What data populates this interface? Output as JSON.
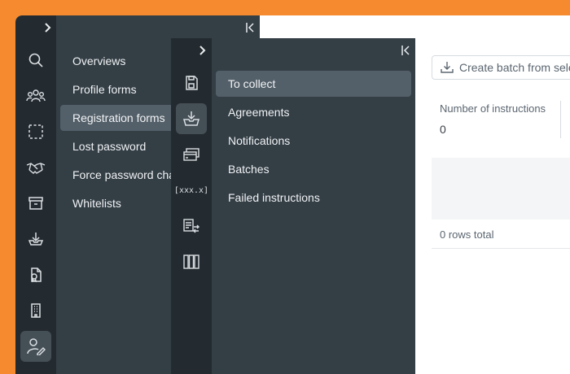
{
  "colors": {
    "background_accent": "#f58a2e",
    "rail_bg": "#242b30",
    "panel_bg": "#333e45",
    "active_item_bg": "#546069"
  },
  "rail1": {
    "icons": [
      "search-icon",
      "users-icon",
      "dashed-square-icon",
      "handshake-icon",
      "archive-icon",
      "download-tray-icon",
      "document-stamp-icon",
      "building-icon",
      "user-edit-icon"
    ],
    "active_icon": "user-edit-icon"
  },
  "panel1": {
    "items": [
      {
        "label": "Overviews"
      },
      {
        "label": "Profile forms"
      },
      {
        "label": "Registration forms"
      },
      {
        "label": "Lost password"
      },
      {
        "label": "Force password cha"
      },
      {
        "label": "Whitelists"
      }
    ],
    "active_item": "Registration forms"
  },
  "rail2": {
    "icons": [
      "floppy-disk-icon",
      "download-tray-icon",
      "credit-cards-icon",
      "variable-bracket-icon",
      "invoice-exchange-icon",
      "book-columns-icon"
    ],
    "bracket_text": "[xxx.x]",
    "active_icon": "download-tray-icon"
  },
  "panel2": {
    "items": [
      {
        "label": "To collect"
      },
      {
        "label": "Agreements"
      },
      {
        "label": "Notifications"
      },
      {
        "label": "Batches"
      },
      {
        "label": "Failed instructions"
      }
    ],
    "active_item": "To collect"
  },
  "main": {
    "batch_button_label": "Create batch from selec",
    "column_header": "Number of instructions",
    "column_value": "0",
    "rows_total": "0 rows total"
  }
}
